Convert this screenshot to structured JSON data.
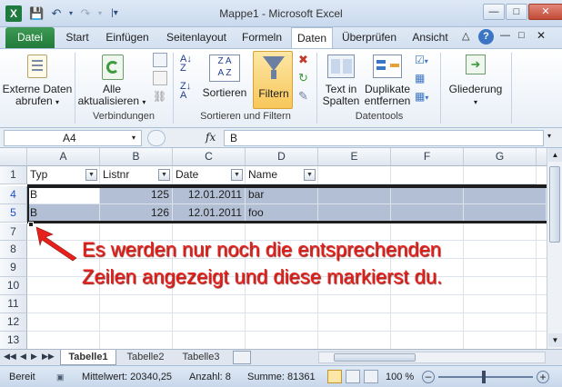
{
  "window": {
    "app_icon": "X",
    "title": "Mappe1 - Microsoft Excel"
  },
  "tabs": [
    "Datei",
    "Start",
    "Einfügen",
    "Seitenlayout",
    "Formeln",
    "Daten",
    "Überprüfen",
    "Ansicht"
  ],
  "ribbon": {
    "external_data": {
      "line1": "Externe Daten",
      "line2": "abrufen"
    },
    "refresh_all": {
      "line1": "Alle",
      "line2": "aktualisieren"
    },
    "sort": "Sortieren",
    "filter": "Filtern",
    "text_to_columns": {
      "line1": "Text in",
      "line2": "Spalten"
    },
    "remove_duplicates": {
      "line1": "Duplikate",
      "line2": "entfernen"
    },
    "outline": "Gliederung",
    "groups": {
      "connections": "Verbindungen",
      "sort_filter": "Sortieren und Filtern",
      "data_tools": "Datentools"
    }
  },
  "formula_bar": {
    "name_box": "A4",
    "fx": "fx",
    "value": "B"
  },
  "grid": {
    "columns": [
      "A",
      "B",
      "C",
      "D",
      "E",
      "F",
      "G"
    ],
    "row_numbers": [
      "1",
      "4",
      "5",
      "7",
      "8",
      "9",
      "10",
      "11",
      "12",
      "13"
    ],
    "header": [
      "Typ",
      "Listnr",
      "Date",
      "Name"
    ],
    "rows": [
      [
        "B",
        "125",
        "12.01.2011",
        "bar"
      ],
      [
        "B",
        "126",
        "12.01.2011",
        "foo"
      ]
    ]
  },
  "sheets": [
    "Tabelle1",
    "Tabelle2",
    "Tabelle3"
  ],
  "status": {
    "ready": "Bereit",
    "average": "Mittelwert: 20340,25",
    "count": "Anzahl: 8",
    "sum": "Summe: 81361",
    "zoom": "100 %"
  },
  "annotation": {
    "line1": "Es werden nur noch die entsprechenden",
    "line2": "Zeilen angezeigt und diese markierst du."
  }
}
